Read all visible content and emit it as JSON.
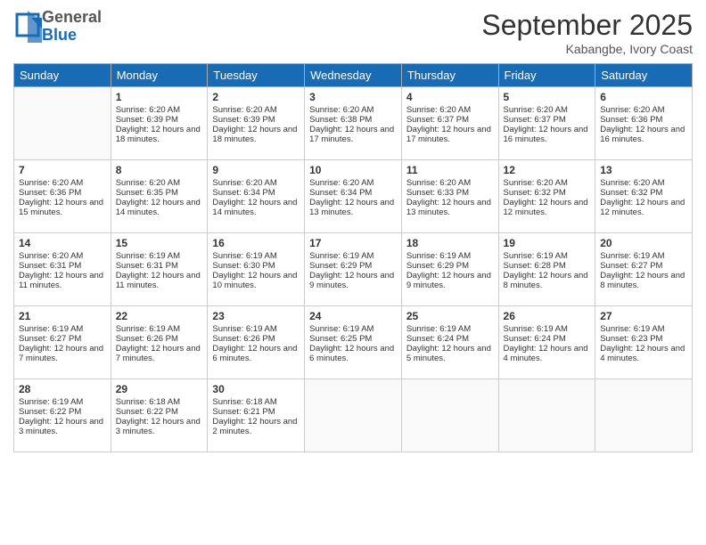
{
  "header": {
    "logo": {
      "general": "General",
      "blue": "Blue"
    },
    "title": "September 2025",
    "location": "Kabangbe, Ivory Coast"
  },
  "days_of_week": [
    "Sunday",
    "Monday",
    "Tuesday",
    "Wednesday",
    "Thursday",
    "Friday",
    "Saturday"
  ],
  "weeks": [
    [
      {
        "num": "",
        "empty": true
      },
      {
        "num": "1",
        "sunrise": "6:20 AM",
        "sunset": "6:39 PM",
        "daylight": "12 hours and 18 minutes."
      },
      {
        "num": "2",
        "sunrise": "6:20 AM",
        "sunset": "6:39 PM",
        "daylight": "12 hours and 18 minutes."
      },
      {
        "num": "3",
        "sunrise": "6:20 AM",
        "sunset": "6:38 PM",
        "daylight": "12 hours and 17 minutes."
      },
      {
        "num": "4",
        "sunrise": "6:20 AM",
        "sunset": "6:37 PM",
        "daylight": "12 hours and 17 minutes."
      },
      {
        "num": "5",
        "sunrise": "6:20 AM",
        "sunset": "6:37 PM",
        "daylight": "12 hours and 16 minutes."
      },
      {
        "num": "6",
        "sunrise": "6:20 AM",
        "sunset": "6:36 PM",
        "daylight": "12 hours and 16 minutes."
      }
    ],
    [
      {
        "num": "7",
        "sunrise": "6:20 AM",
        "sunset": "6:36 PM",
        "daylight": "12 hours and 15 minutes."
      },
      {
        "num": "8",
        "sunrise": "6:20 AM",
        "sunset": "6:35 PM",
        "daylight": "12 hours and 14 minutes."
      },
      {
        "num": "9",
        "sunrise": "6:20 AM",
        "sunset": "6:34 PM",
        "daylight": "12 hours and 14 minutes."
      },
      {
        "num": "10",
        "sunrise": "6:20 AM",
        "sunset": "6:34 PM",
        "daylight": "12 hours and 13 minutes."
      },
      {
        "num": "11",
        "sunrise": "6:20 AM",
        "sunset": "6:33 PM",
        "daylight": "12 hours and 13 minutes."
      },
      {
        "num": "12",
        "sunrise": "6:20 AM",
        "sunset": "6:32 PM",
        "daylight": "12 hours and 12 minutes."
      },
      {
        "num": "13",
        "sunrise": "6:20 AM",
        "sunset": "6:32 PM",
        "daylight": "12 hours and 12 minutes."
      }
    ],
    [
      {
        "num": "14",
        "sunrise": "6:20 AM",
        "sunset": "6:31 PM",
        "daylight": "12 hours and 11 minutes."
      },
      {
        "num": "15",
        "sunrise": "6:19 AM",
        "sunset": "6:31 PM",
        "daylight": "12 hours and 11 minutes."
      },
      {
        "num": "16",
        "sunrise": "6:19 AM",
        "sunset": "6:30 PM",
        "daylight": "12 hours and 10 minutes."
      },
      {
        "num": "17",
        "sunrise": "6:19 AM",
        "sunset": "6:29 PM",
        "daylight": "12 hours and 9 minutes."
      },
      {
        "num": "18",
        "sunrise": "6:19 AM",
        "sunset": "6:29 PM",
        "daylight": "12 hours and 9 minutes."
      },
      {
        "num": "19",
        "sunrise": "6:19 AM",
        "sunset": "6:28 PM",
        "daylight": "12 hours and 8 minutes."
      },
      {
        "num": "20",
        "sunrise": "6:19 AM",
        "sunset": "6:27 PM",
        "daylight": "12 hours and 8 minutes."
      }
    ],
    [
      {
        "num": "21",
        "sunrise": "6:19 AM",
        "sunset": "6:27 PM",
        "daylight": "12 hours and 7 minutes."
      },
      {
        "num": "22",
        "sunrise": "6:19 AM",
        "sunset": "6:26 PM",
        "daylight": "12 hours and 7 minutes."
      },
      {
        "num": "23",
        "sunrise": "6:19 AM",
        "sunset": "6:26 PM",
        "daylight": "12 hours and 6 minutes."
      },
      {
        "num": "24",
        "sunrise": "6:19 AM",
        "sunset": "6:25 PM",
        "daylight": "12 hours and 6 minutes."
      },
      {
        "num": "25",
        "sunrise": "6:19 AM",
        "sunset": "6:24 PM",
        "daylight": "12 hours and 5 minutes."
      },
      {
        "num": "26",
        "sunrise": "6:19 AM",
        "sunset": "6:24 PM",
        "daylight": "12 hours and 4 minutes."
      },
      {
        "num": "27",
        "sunrise": "6:19 AM",
        "sunset": "6:23 PM",
        "daylight": "12 hours and 4 minutes."
      }
    ],
    [
      {
        "num": "28",
        "sunrise": "6:19 AM",
        "sunset": "6:22 PM",
        "daylight": "12 hours and 3 minutes."
      },
      {
        "num": "29",
        "sunrise": "6:18 AM",
        "sunset": "6:22 PM",
        "daylight": "12 hours and 3 minutes."
      },
      {
        "num": "30",
        "sunrise": "6:18 AM",
        "sunset": "6:21 PM",
        "daylight": "12 hours and 2 minutes."
      },
      {
        "num": "",
        "empty": true
      },
      {
        "num": "",
        "empty": true
      },
      {
        "num": "",
        "empty": true
      },
      {
        "num": "",
        "empty": true
      }
    ]
  ]
}
